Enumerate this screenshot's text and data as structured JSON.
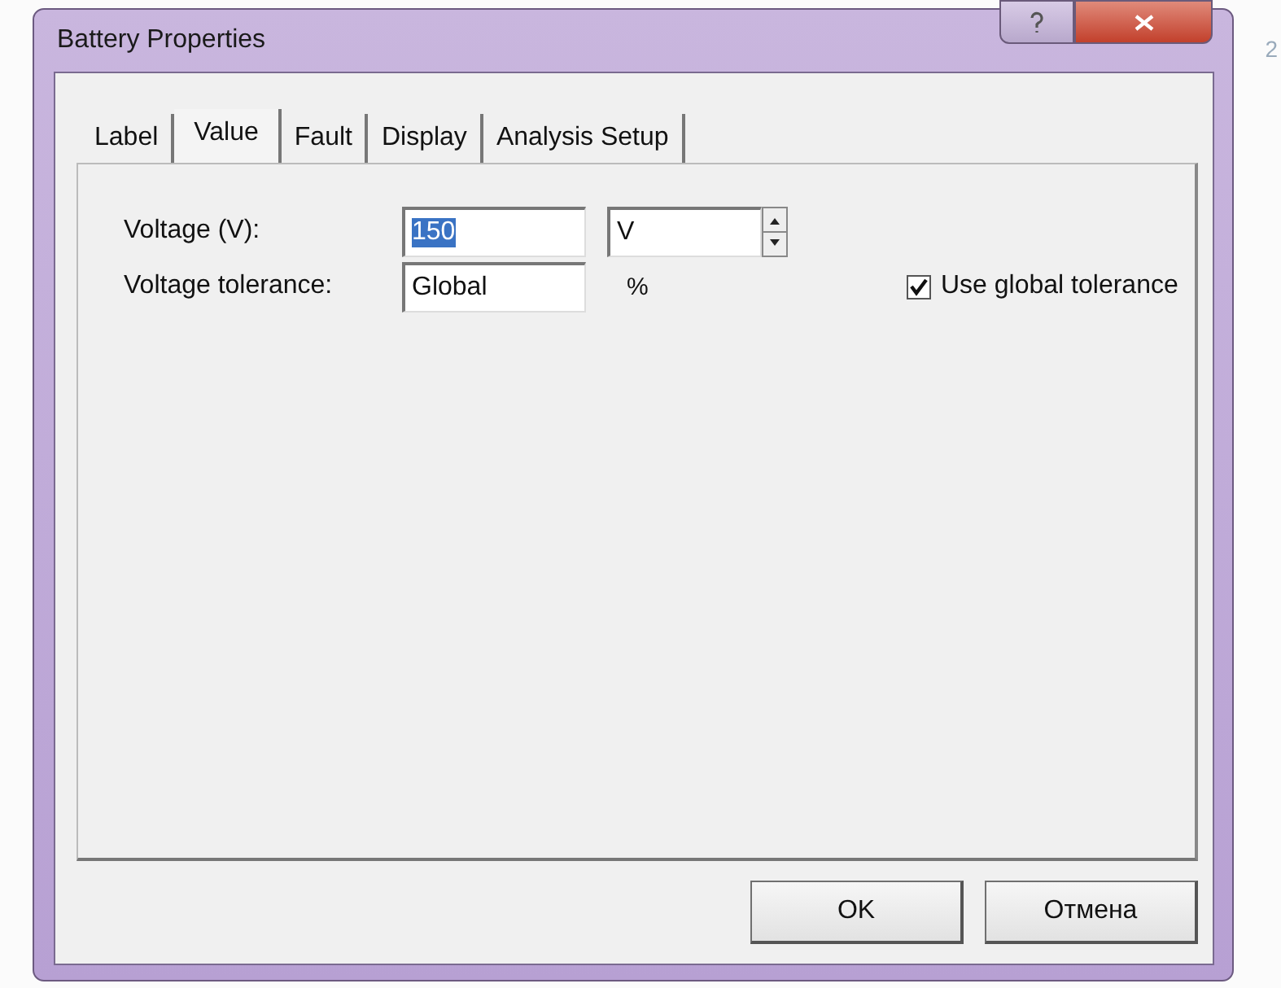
{
  "window": {
    "title": "Battery Properties"
  },
  "background_text": "2",
  "tabs": [
    {
      "label": "Label",
      "selected": false
    },
    {
      "label": "Value",
      "selected": true
    },
    {
      "label": "Fault",
      "selected": false
    },
    {
      "label": "Display",
      "selected": false
    },
    {
      "label": "Analysis Setup",
      "selected": false
    }
  ],
  "voltage": {
    "label": "Voltage (V):",
    "value": "150",
    "value_selected": true,
    "unit": "V"
  },
  "tolerance": {
    "label": "Voltage tolerance:",
    "value": "Global",
    "unit": "%"
  },
  "use_global_tolerance": {
    "label": "Use global tolerance",
    "checked": true
  },
  "buttons": [
    "OK",
    "Отмена"
  ]
}
